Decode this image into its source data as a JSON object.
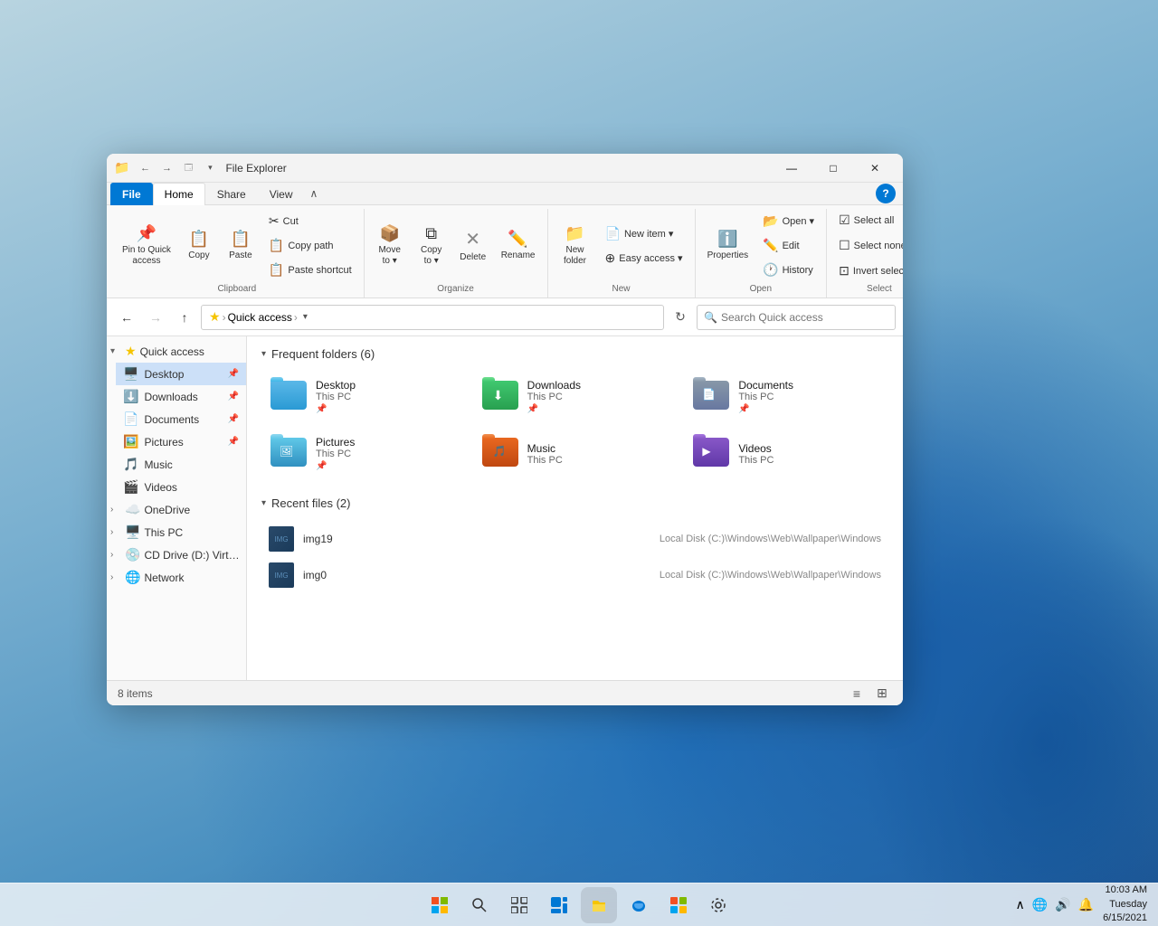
{
  "desktop": {
    "background": "Windows 11 blue wallpaper"
  },
  "taskbar": {
    "time": "10:03 AM",
    "date": "Tuesday\n6/15/2021",
    "icons": [
      {
        "name": "start",
        "symbol": "⊞"
      },
      {
        "name": "search",
        "symbol": "🔍"
      },
      {
        "name": "task-view",
        "symbol": "❑"
      },
      {
        "name": "widgets",
        "symbol": "▦"
      },
      {
        "name": "file-explorer",
        "symbol": "📁"
      },
      {
        "name": "edge",
        "symbol": "⊕"
      },
      {
        "name": "microsoft-store",
        "symbol": "🛍"
      },
      {
        "name": "settings",
        "symbol": "⚙"
      }
    ]
  },
  "window": {
    "title": "File Explorer",
    "title_icon": "📁",
    "controls": {
      "minimize": "—",
      "maximize": "□",
      "close": "✕"
    }
  },
  "ribbon": {
    "tabs": [
      {
        "label": "File",
        "active": false,
        "file": true
      },
      {
        "label": "Home",
        "active": true,
        "file": false
      },
      {
        "label": "Share",
        "active": false,
        "file": false
      },
      {
        "label": "View",
        "active": false,
        "file": false
      }
    ],
    "groups": {
      "clipboard": {
        "label": "Clipboard",
        "buttons": [
          {
            "id": "pin-quick-access",
            "icon": "📌",
            "label": "Pin to Quick\naccess"
          },
          {
            "id": "copy",
            "icon": "📋",
            "label": "Copy"
          },
          {
            "id": "paste",
            "icon": "📋",
            "label": "Paste"
          }
        ],
        "small_buttons": [
          {
            "id": "cut",
            "icon": "✂",
            "label": "Cut"
          },
          {
            "id": "copy-path",
            "icon": "📋",
            "label": "Copy path"
          },
          {
            "id": "paste-shortcut",
            "icon": "📋",
            "label": "Paste shortcut"
          }
        ]
      },
      "organize": {
        "label": "Organize",
        "buttons": [
          {
            "id": "move-to",
            "icon": "→",
            "label": "Move\nto ▾"
          },
          {
            "id": "copy-to",
            "icon": "⧉",
            "label": "Copy\nto ▾"
          },
          {
            "id": "delete",
            "icon": "✕",
            "label": "Delete"
          },
          {
            "id": "rename",
            "icon": "✏",
            "label": "Rename"
          }
        ]
      },
      "new": {
        "label": "New",
        "buttons": [
          {
            "id": "new-folder",
            "icon": "📁",
            "label": "New\nfolder"
          }
        ],
        "small_buttons": [
          {
            "id": "new-item",
            "icon": "📄",
            "label": "New item ▾"
          },
          {
            "id": "easy-access",
            "icon": "⊕",
            "label": "Easy access ▾"
          }
        ]
      },
      "open": {
        "label": "Open",
        "buttons": [
          {
            "id": "properties",
            "icon": "ℹ",
            "label": "Properties"
          }
        ],
        "small_buttons": [
          {
            "id": "open-btn",
            "icon": "📂",
            "label": "Open ▾"
          },
          {
            "id": "edit",
            "icon": "✏",
            "label": "Edit"
          },
          {
            "id": "history",
            "icon": "🕐",
            "label": "History"
          }
        ]
      },
      "select": {
        "label": "Select",
        "small_buttons": [
          {
            "id": "select-all",
            "icon": "☑",
            "label": "Select all"
          },
          {
            "id": "select-none",
            "icon": "☐",
            "label": "Select none"
          },
          {
            "id": "invert-selection",
            "icon": "⊡",
            "label": "Invert selection"
          }
        ]
      }
    }
  },
  "address_bar": {
    "back_btn": "←",
    "forward_btn": "→",
    "up_btn": "↑",
    "star": "★",
    "path_parts": [
      "Quick access"
    ],
    "breadcrumb": "Quick access",
    "chevron": "▾",
    "refresh": "↻",
    "search_placeholder": "Search Quick access",
    "search_icon": "🔍"
  },
  "sidebar": {
    "quick_access": {
      "label": "Quick access",
      "expanded": true,
      "items": [
        {
          "label": "Desktop",
          "icon": "🖥",
          "pinned": true
        },
        {
          "label": "Downloads",
          "icon": "⬇",
          "pinned": true
        },
        {
          "label": "Documents",
          "icon": "📄",
          "pinned": true
        },
        {
          "label": "Pictures",
          "icon": "🖼",
          "pinned": true
        },
        {
          "label": "Music",
          "icon": "🎵",
          "pinned": false
        },
        {
          "label": "Videos",
          "icon": "🎬",
          "pinned": false
        }
      ]
    },
    "onedrive": {
      "label": "OneDrive",
      "expanded": false
    },
    "this_pc": {
      "label": "This PC",
      "expanded": false
    },
    "cd_drive": {
      "label": "CD Drive (D:) Virtuall",
      "expanded": false
    },
    "network": {
      "label": "Network",
      "expanded": false
    }
  },
  "content": {
    "frequent_folders": {
      "title": "Frequent folders (6)",
      "collapsed": false,
      "folders": [
        {
          "name": "Desktop",
          "sub": "This PC",
          "icon_type": "desktop",
          "pinned": true
        },
        {
          "name": "Downloads",
          "sub": "This PC",
          "icon_type": "downloads",
          "pinned": true
        },
        {
          "name": "Documents",
          "sub": "This PC",
          "icon_type": "documents",
          "pinned": true
        },
        {
          "name": "Pictures",
          "sub": "This PC",
          "icon_type": "pictures",
          "pinned": true
        },
        {
          "name": "Music",
          "sub": "This PC",
          "icon_type": "music",
          "pinned": false
        },
        {
          "name": "Videos",
          "sub": "This PC",
          "icon_type": "videos",
          "pinned": false
        }
      ]
    },
    "recent_files": {
      "title": "Recent files (2)",
      "collapsed": false,
      "files": [
        {
          "name": "img19",
          "path": "Local Disk (C:)\\Windows\\Web\\Wallpaper\\Windows"
        },
        {
          "name": "img0",
          "path": "Local Disk (C:)\\Windows\\Web\\Wallpaper\\Windows"
        }
      ]
    }
  },
  "status_bar": {
    "count": "8 items",
    "view_list": "≡",
    "view_grid": "⊞"
  }
}
